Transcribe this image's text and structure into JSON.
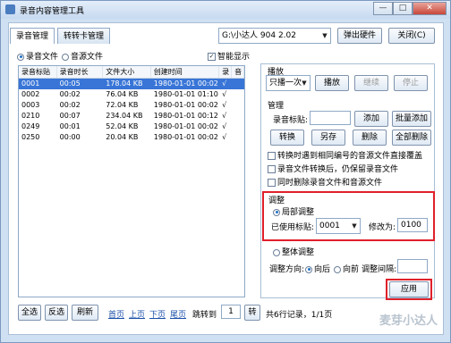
{
  "window": {
    "title": "录音内容管理工具",
    "btn_min": "—",
    "btn_max": "□",
    "btn_close": "✕"
  },
  "tabs": [
    {
      "label": "录音管理"
    },
    {
      "label": "转转卡管理"
    }
  ],
  "device": {
    "value": "G:\\小达人 904 2.02",
    "eject": "弹出硬件",
    "close": "关闭(C)"
  },
  "filter": {
    "record": "录音文件",
    "source": "音源文件",
    "smart": "智能显示"
  },
  "table": {
    "headers": [
      "录音标贴",
      "录音时长",
      "文件大小",
      "创建时间",
      "录",
      "音"
    ],
    "rows": [
      [
        "0001",
        "00:05",
        "178.04 KB",
        "1980-01-01 00:02",
        "√",
        ""
      ],
      [
        "0002",
        "00:02",
        "76.04 KB",
        "1980-01-01 01:10",
        "√",
        ""
      ],
      [
        "0003",
        "00:02",
        "72.04 KB",
        "1980-01-01 00:02",
        "√",
        ""
      ],
      [
        "0210",
        "00:07",
        "234.04 KB",
        "1980-01-01 00:12",
        "√",
        ""
      ],
      [
        "0249",
        "00:01",
        "52.04 KB",
        "1980-01-01 00:02",
        "√",
        ""
      ],
      [
        "0250",
        "00:00",
        "20.04 KB",
        "1980-01-01 00:02",
        "√",
        ""
      ]
    ]
  },
  "play": {
    "title": "播放",
    "mode": "只播一次",
    "play": "播放",
    "continue": "继续",
    "stop": "停止"
  },
  "manage": {
    "title": "管理",
    "label_text": "录音标贴:",
    "add": "添加",
    "batch_add": "批量添加",
    "convert": "转换",
    "save_as": "另存",
    "delete": "删除",
    "delete_all": "全部删除",
    "opt1": "转换时遇到相同编号的音源文件直接覆盖",
    "opt2": "录音文件转换后，仍保留录音文件",
    "opt3": "同时删除录音文件和音源文件"
  },
  "adjust": {
    "title": "调整",
    "local": "局部调整",
    "use_label": "已使用标贴:",
    "use_value": "0001",
    "modify_to": "修改为:",
    "modify_value": "0100",
    "global": "整体调整",
    "direction": "调整方向:",
    "backward": "向后",
    "forward": "向前",
    "interval": "调整间隔:",
    "apply": "应用"
  },
  "footer": {
    "select_all": "全选",
    "invert": "反选",
    "refresh": "刷新",
    "first": "首页",
    "prev": "上页",
    "next": "下页",
    "last": "尾页",
    "goto": "跳转到",
    "page_input": "1",
    "go": "转",
    "status": "共6行记录，1/1页"
  },
  "watermark": "麦芽小达人"
}
